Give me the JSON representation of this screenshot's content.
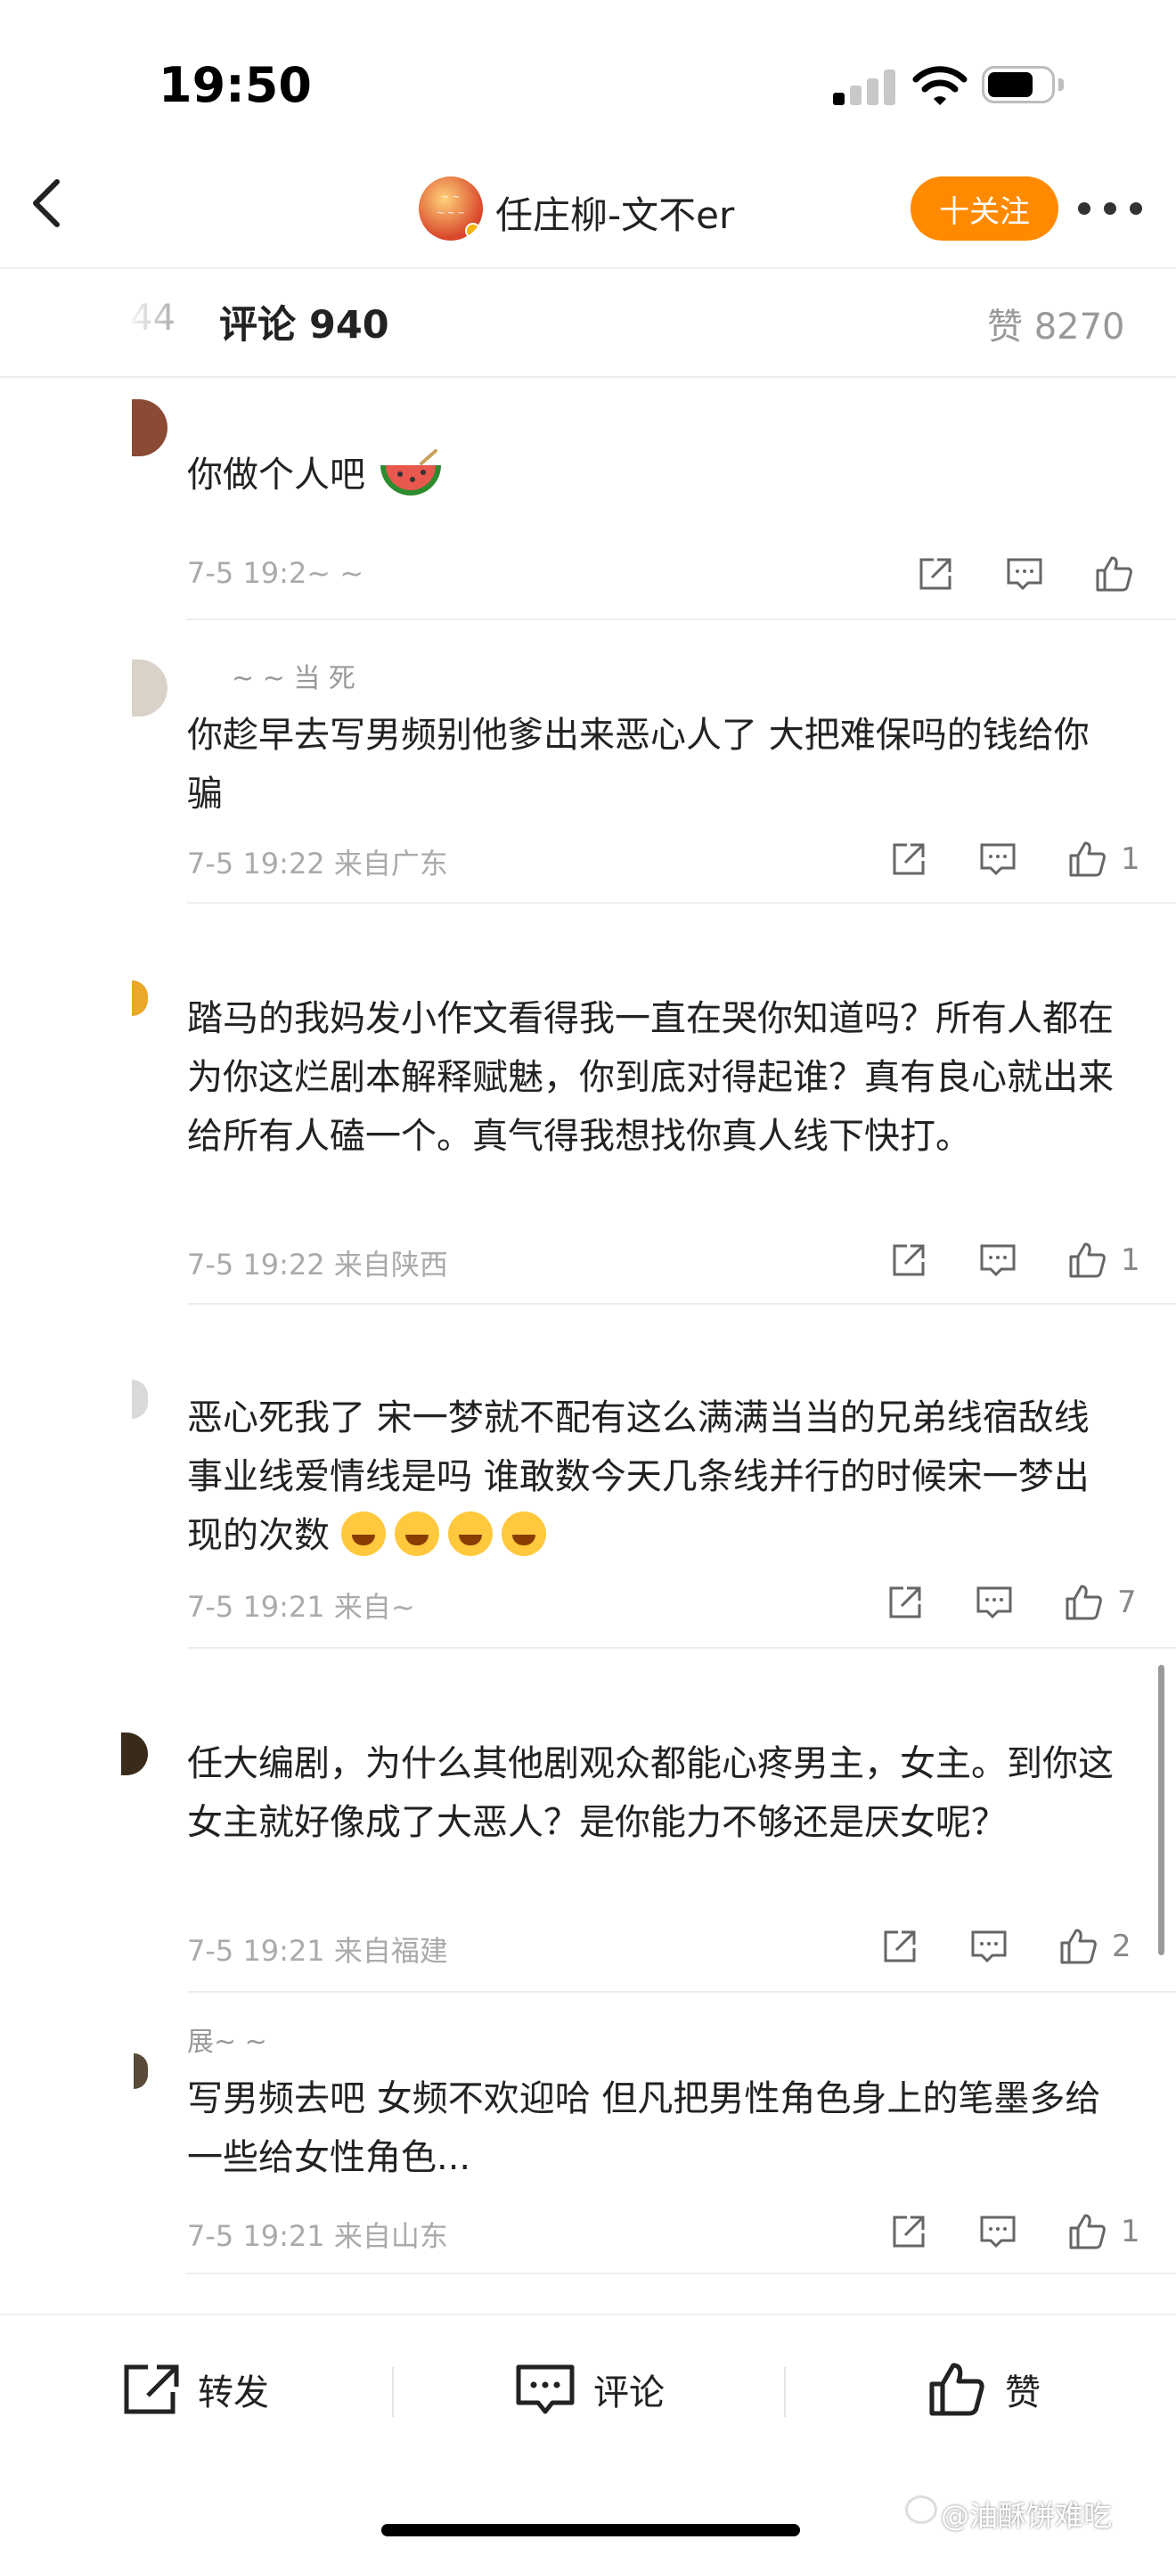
{
  "status_bar": {
    "time": "19:50"
  },
  "header": {
    "username": "任庄柳-文不er",
    "follow_label": "十关注"
  },
  "tabs": {
    "forward_count": "44",
    "comment_label": "评论 940",
    "likes_label": "赞 8270"
  },
  "comments": [
    {
      "text": "你做个人吧",
      "meta": "7-5 19:2~ ~",
      "likes": ""
    },
    {
      "name": "~ ~ 当 死",
      "text": "你趁早去写男频别他爹出来恶心人了 大把难保吗的钱给你骗",
      "meta": "7-5 19:22  来自广东",
      "likes": "1"
    },
    {
      "text": "踏马的我妈发小作文看得我一直在哭你知道吗？所有人都在为你这烂剧本解释赋魅，你到底对得起谁？真有良心就出来给所有人磕一个。真气得我想找你真人线下快打。",
      "meta": "7-5 19:22  来自陕西",
      "likes": "1"
    },
    {
      "text": "恶心死我了 宋一梦就不配有这么满满当当的兄弟线宿敌线事业线爱情线是吗 谁敢数今天几条线并行的时候宋一梦出现的次数",
      "meta": "7-5 19:21  来自~",
      "likes": "7"
    },
    {
      "text": "任大编剧，为什么其他剧观众都能心疼男主，女主。到你这女主就好像成了大恶人？是你能力不够还是厌女呢？",
      "meta": "7-5 19:21  来自福建",
      "likes": "2"
    },
    {
      "name": "展~ ~",
      "text": "写男频去吧 女频不欢迎哈 但凡把男性角色身上的笔墨多给一些给女性角色...",
      "meta": "7-5 19:21  来自山东",
      "likes": "1"
    }
  ],
  "bottom_bar": {
    "forward_label": "转发",
    "comment_label": "评论",
    "like_label": "赞"
  },
  "watermark": "@油酥饼难吃",
  "colors": {
    "accent": "#ff8a00",
    "text": "#222222",
    "meta": "#aaaaaa"
  }
}
